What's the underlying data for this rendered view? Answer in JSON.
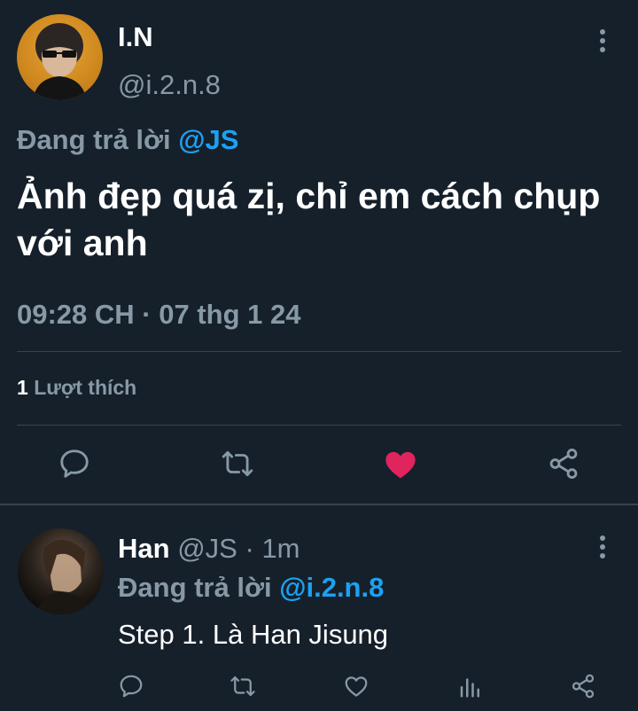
{
  "main_tweet": {
    "author_name": "I.N",
    "author_handle": "@i.2.n.8",
    "replying_prefix": "Đang trả lời",
    "replying_to": "@JS",
    "text": "Ảnh đẹp quá zị, chỉ em cách chụp với anh",
    "timestamp": "09:28 CH · 07 thg 1 24",
    "like_count": "1",
    "like_label": "Lượt thích",
    "liked": true,
    "accent_color": "#1da1f2",
    "like_color": "#e0245e"
  },
  "reply_tweet": {
    "author_name": "Han",
    "author_handle": "@JS",
    "separator": "·",
    "time_ago": "1m",
    "replying_prefix": "Đang trả lời",
    "replying_to": "@i.2.n.8",
    "text": "Step 1. Là Han Jisung"
  },
  "icons": {
    "more": "more-vertical-icon",
    "reply": "comment-icon",
    "retweet": "retweet-icon",
    "like": "heart-icon",
    "analytics": "analytics-icon",
    "share": "share-icon"
  }
}
